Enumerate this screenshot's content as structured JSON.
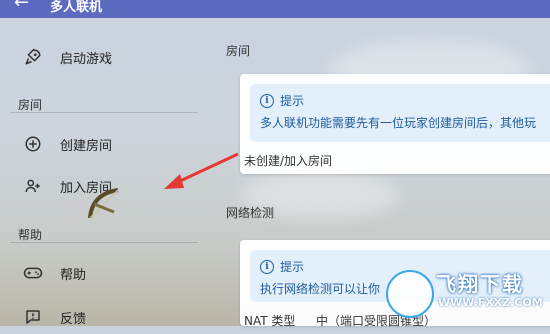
{
  "header": {
    "back_icon": "arrow-left-icon",
    "title": "多人联机"
  },
  "sidebar": {
    "launch": {
      "label": "启动游戏",
      "icon": "rocket-icon"
    },
    "room_section": "房间",
    "create": {
      "label": "创建房间",
      "icon": "plus-circle-icon"
    },
    "join": {
      "label": "加入房间",
      "icon": "person-add-icon"
    },
    "help_section": "帮助",
    "help": {
      "label": "帮助",
      "icon": "gamepad-icon"
    },
    "feedback": {
      "label": "反馈",
      "icon": "feedback-icon"
    }
  },
  "main": {
    "room": {
      "title": "房间",
      "tip_title": "提示",
      "tip_text": "多人联机功能需要先有一位玩家创建房间后，其他玩",
      "status": "未创建/加入房间"
    },
    "network": {
      "title": "网络检测",
      "tip_title": "提示",
      "tip_text": "执行网络检测可以让你",
      "nat_label": "NAT 类型",
      "nat_value": "中（端口受限圆锥型）"
    }
  },
  "watermark": {
    "brand": "飞翔下载",
    "url": "WWW.FXXZ.COM"
  },
  "colors": {
    "header": "#5c6bc0",
    "tip_bg": "#e3f0fb",
    "tip_text": "#1e5a9e",
    "arrow": "#e53935"
  }
}
